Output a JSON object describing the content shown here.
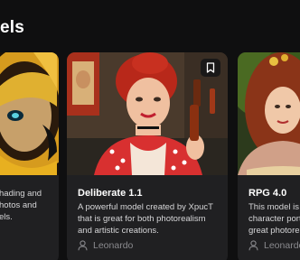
{
  "section": {
    "title": "els"
  },
  "cards": [
    {
      "title": "",
      "description": "hading and\nhotos and\nels.",
      "author": ""
    },
    {
      "title": "Deliberate 1.1",
      "description": "A powerful model created by XpucT that is great for both photorealism and artistic creations.",
      "author": "Leonardo",
      "bookmark_icon": "bookmark-icon"
    },
    {
      "title": "RPG 4.0",
      "description": "This model is b character port great photorea",
      "author": "Leonardo"
    }
  ],
  "colors": {
    "background": "#0f0f10",
    "card": "#202022",
    "muted_text": "#8a8a8e"
  }
}
